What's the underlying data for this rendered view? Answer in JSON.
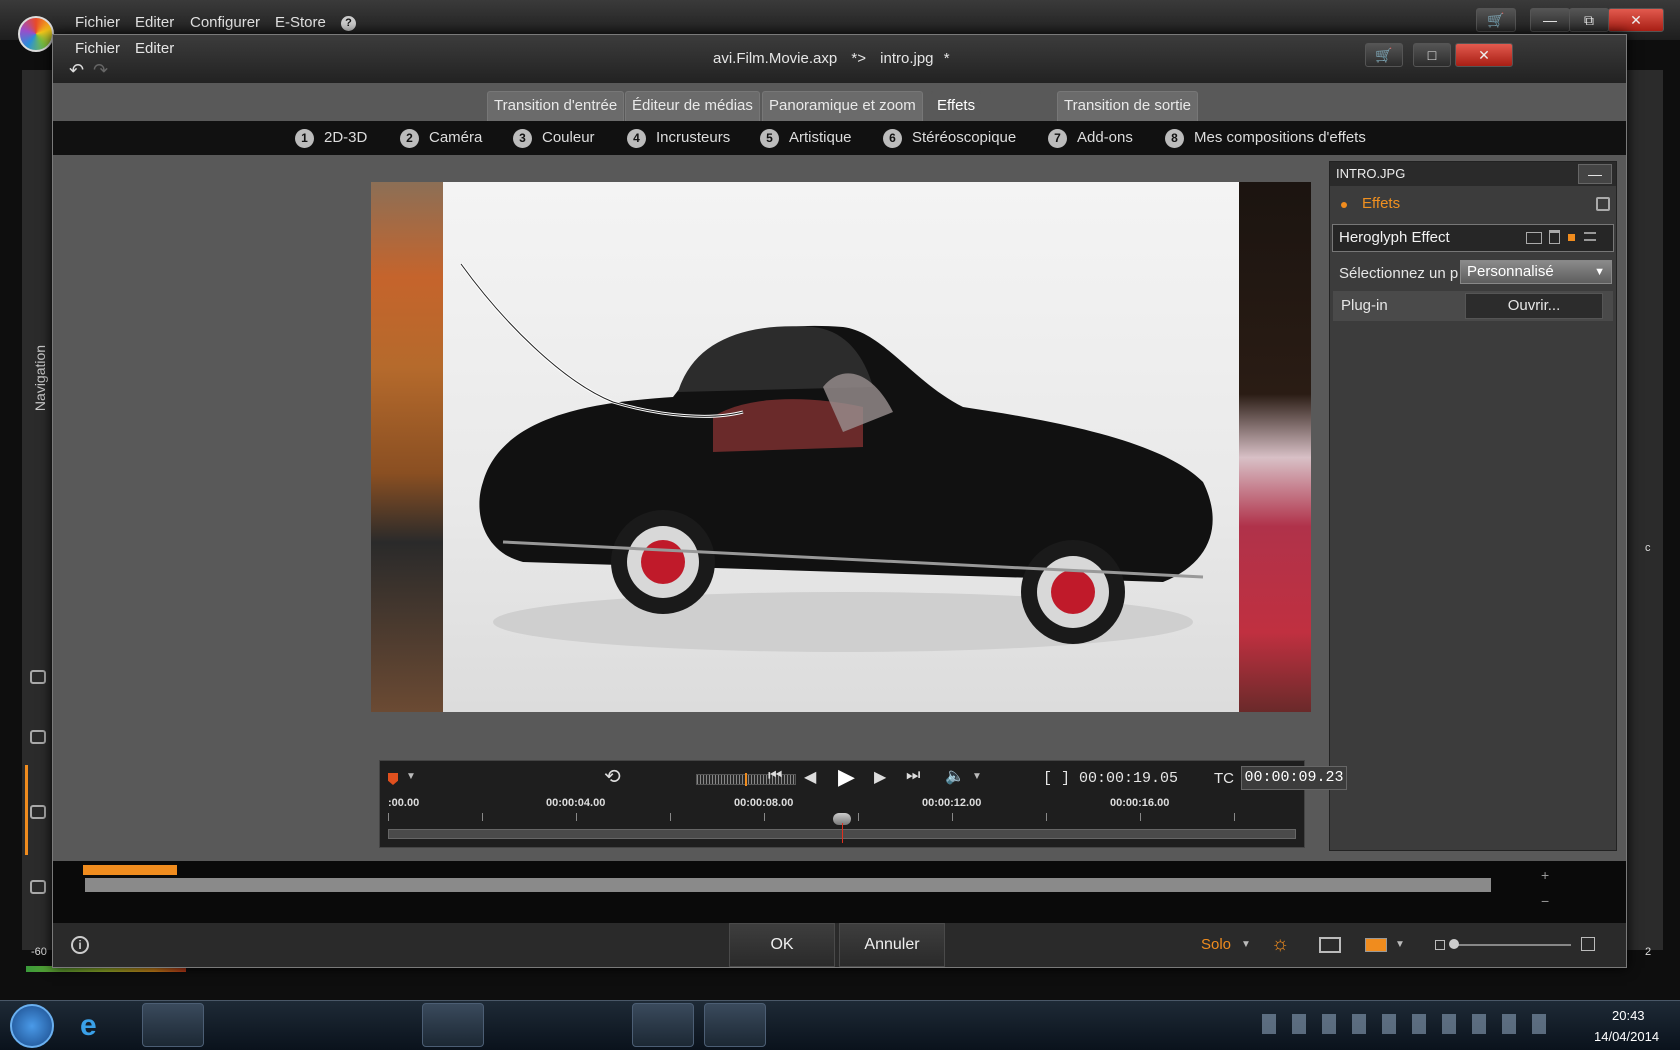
{
  "outer_menu": [
    "Fichier",
    "Editer",
    "Configurer",
    "E-Store"
  ],
  "left_panel_label": "Navigation",
  "dialog": {
    "menu": [
      "Fichier",
      "Editer"
    ],
    "title_project": "avi.Film.Movie.axp",
    "title_separator": "*>",
    "title_file": "intro.jpg",
    "title_modified": "*"
  },
  "tabs": [
    {
      "label": "Transition d'entrée"
    },
    {
      "label": "Éditeur de médias"
    },
    {
      "label": "Panoramique et zoom"
    },
    {
      "label": "Effets",
      "active": true
    },
    {
      "label": "Transition de sortie"
    }
  ],
  "categories": [
    {
      "num": "1",
      "label": "2D-3D"
    },
    {
      "num": "2",
      "label": "Caméra"
    },
    {
      "num": "3",
      "label": "Couleur"
    },
    {
      "num": "4",
      "label": "Incrusteurs"
    },
    {
      "num": "5",
      "label": "Artistique"
    },
    {
      "num": "6",
      "label": "Stéréoscopique"
    },
    {
      "num": "7",
      "label": "Add-ons"
    },
    {
      "num": "8",
      "label": "Mes compositions d'effets"
    }
  ],
  "panel": {
    "header": "INTRO.JPG",
    "effects_label": "Effets",
    "effect_name": "Heroglyph Effect",
    "preset_label": "Sélectionnez un p",
    "preset_value": "Personnalisé",
    "plugin_label": "Plug-in",
    "open_button": "Ouvrir..."
  },
  "transport": {
    "duration": "[ ] 00:00:19.05",
    "tc_label": "TC",
    "timecode": "00:00:09.23",
    "ruler": [
      ":00.00",
      "00:00:04.00",
      "00:00:08.00",
      "00:00:12.00",
      "00:00:16.00"
    ],
    "playhead_fraction": 0.5
  },
  "footer": {
    "ok": "OK",
    "cancel": "Annuler",
    "solo": "Solo"
  },
  "side_readouts": {
    "level": "-60",
    "right_c": "c",
    "right_2": "2"
  },
  "clock": {
    "time": "20:43",
    "date": "14/04/2014"
  },
  "colors": {
    "accent": "#f08c1e",
    "close_red": "#c8281e"
  }
}
